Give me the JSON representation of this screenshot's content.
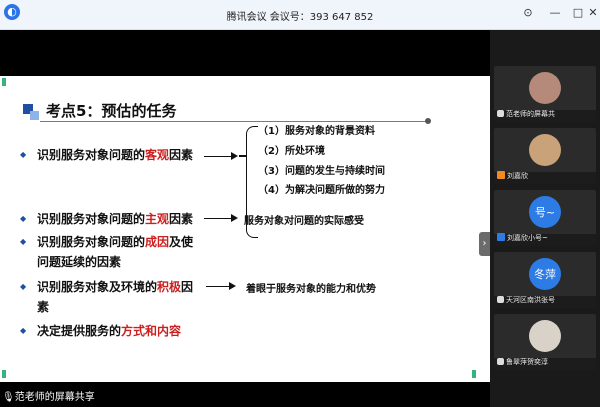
{
  "window": {
    "title": "腾讯会议  会议号：393 647 852",
    "logo": "tencent-meeting-logo"
  },
  "slide": {
    "title": "考点5：预估的任务",
    "items": [
      {
        "prefix": "识别服务对象问题的",
        "highlight": "客观",
        "suffix": "因素"
      },
      {
        "prefix": "识别服务对象问题的",
        "highlight": "主观",
        "suffix": "因素"
      },
      {
        "prefix": "识别服务对象问题的",
        "highlight": "成因",
        "suffix": "及使"
      },
      {
        "line2": "问题延续的因素"
      },
      {
        "prefix": "识别服务对象及环境的",
        "highlight": "积极",
        "suffix": "因"
      },
      {
        "line2": "素"
      },
      {
        "prefix": "决定提供服务的",
        "highlight": "方式和内容",
        "suffix": ""
      }
    ],
    "objective_details": [
      "（1）服务对象的背景资料",
      "（2）所处环境",
      "（3）问题的发生与持续时间",
      "（4）为解决问题所做的努力"
    ],
    "subjective_note": "服务对象对问题的实际感受",
    "positive_note": "着眼于服务对象的能力和优势"
  },
  "presenter": {
    "label": "范老师的屏幕共享"
  },
  "participants": [
    {
      "name": "范老师的屏幕共",
      "avatar_text": "",
      "avatar_color": "#b58a7a"
    },
    {
      "name": "刘嘉欣",
      "avatar_text": "",
      "avatar_color": "#c9a27a"
    },
    {
      "name": "刘嘉欣小号~",
      "avatar_text": "号~",
      "avatar_color": "#2d7be5"
    },
    {
      "name": "天河区南洪张号",
      "avatar_text": "冬萍",
      "avatar_color": "#2d7be5"
    },
    {
      "name": "鲁翠萍贺奕淳",
      "avatar_text": "",
      "avatar_color": "#d9d2c9"
    }
  ],
  "colors": {
    "accent_red": "#cc1f1f",
    "bullet_blue": "#1e4fa0",
    "avatar_blue": "#2d7be5"
  }
}
